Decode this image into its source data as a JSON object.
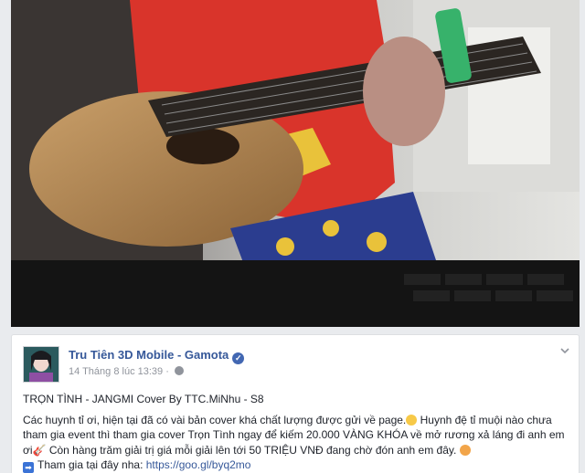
{
  "video": {
    "colors": {
      "shirt": "#d9342b",
      "guitar_body": "#b98a52",
      "wall": "#cfcfcc",
      "keyboard": "#141414",
      "capo": "#37b26b"
    }
  },
  "post": {
    "page_name": "Tru Tiên 3D Mobile - Gamota",
    "timestamp": "14 Tháng 8 lúc 13:39",
    "separator": "·",
    "avatar_icon": "avatar-icon",
    "verified_icon": "verified-badge-icon",
    "privacy_icon": "globe-icon",
    "options_icon": "chevron-down-icon",
    "title": "TRỌN TÌNH - JANGMI Cover By TTC.MiNhu - S8",
    "desc_part1": "Các huynh tỉ ơi, hiện tại đã có vài bản cover khá chất lượng được gửi về page.",
    "desc_part2": " Huynh đệ tỉ muội nào chưa tham gia event thì tham gia cover Trọn Tình ngay để kiếm 20.000 VÀNG KHÓA về mở rương xả láng đi anh em ơi",
    "desc_part3": " Còn hàng trăm giải trị giá mỗi giải lên tới 50 TRIỆU VNĐ đang chờ đón anh em đây.",
    "link_prefix": "Tham gia tại đây nha: ",
    "link_text": "https://goo.gl/byq2mo"
  }
}
